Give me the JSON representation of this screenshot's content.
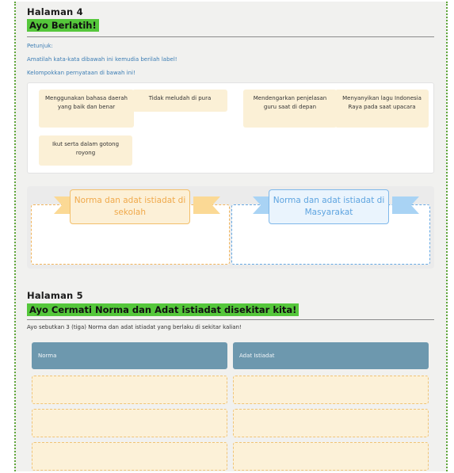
{
  "page4": {
    "title": "Halaman 4",
    "heading": "Ayo Berlatih!",
    "petunjuk_label": "Petunjuk:",
    "instruction1": "Amatilah kata-kata dibawah ini kemudia berilah label!",
    "instruction2": "Kelompokkan pernyataan di bawah ini!",
    "cards": [
      "Menggunakan bahasa daerah yang baik dan benar",
      "Tidak meludah di pura",
      "Mendengarkan penjelasan guru saat di depan",
      "Menyanyikan lagu Indonesia Raya pada saat upacara",
      "Ikut serta dalam gotong royong"
    ],
    "drop_targets": [
      {
        "label": "Norma dan adat istiadat di sekolah",
        "color": "#f0a94b"
      },
      {
        "label": "Norma dan adat istiadat di Masyarakat",
        "color": "#5ea4e0"
      }
    ]
  },
  "page5": {
    "title": "Halaman 5",
    "heading": "Ayo Cermati Norma dan Adat istiadat disekitar kita!",
    "instruction": "Ayo sebutkan 3 (tiga) Norma dan adat istiadat yang berlaku di sekitar kalian!",
    "table": {
      "columns": [
        "Norma",
        "Adat Istiadat"
      ],
      "rows": [
        [
          "",
          ""
        ],
        [
          "",
          ""
        ],
        [
          "",
          ""
        ]
      ]
    }
  },
  "colors": {
    "heading_highlight": "#55c73b",
    "frame_border": "#5fa63a",
    "card_bg": "#fbf0d6",
    "table_header": "#6d98ae"
  }
}
